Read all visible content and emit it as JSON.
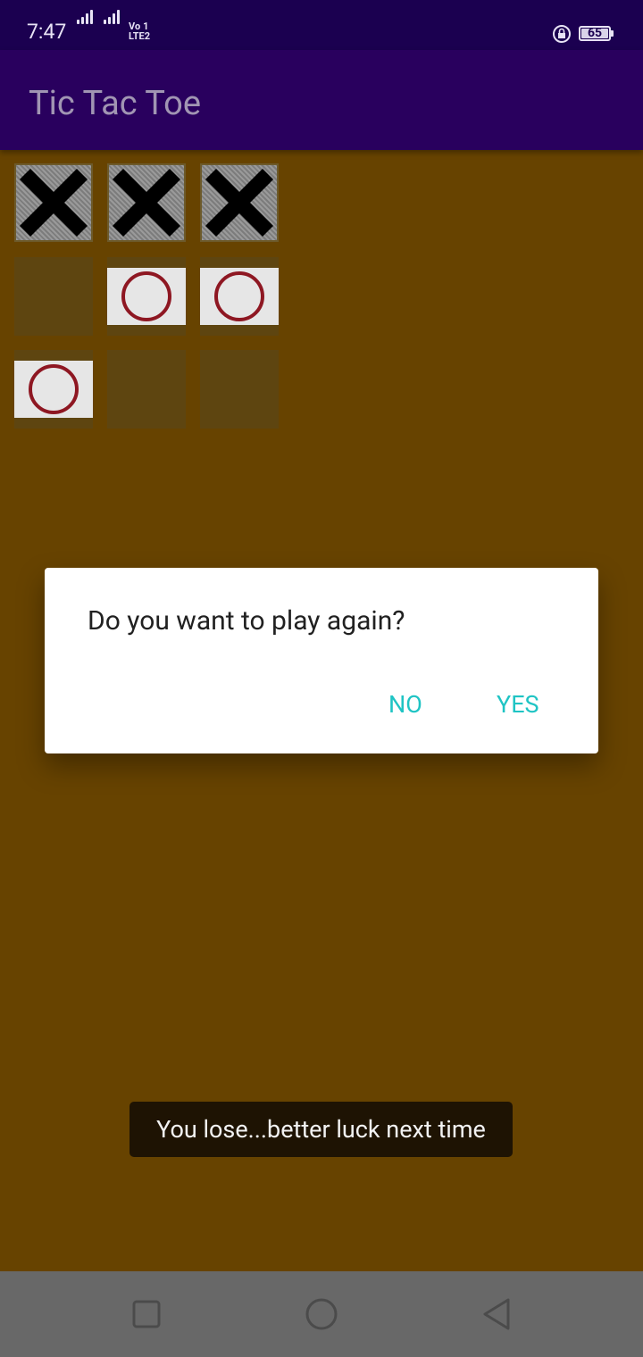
{
  "status_bar": {
    "time": "7:47",
    "network_label_top": "Vo",
    "network_label_bottom": "LTE",
    "sim_top": "1",
    "sim_bottom": "2",
    "battery_level": "65"
  },
  "app_bar": {
    "title": "Tic Tac Toe"
  },
  "board": {
    "cells": [
      "X",
      "X",
      "X",
      "",
      "O",
      "O",
      "O",
      "",
      ""
    ]
  },
  "dialog": {
    "message": "Do you want to play again?",
    "negative_label": "NO",
    "positive_label": "YES"
  },
  "toast": {
    "message": "You lose...better luck next time"
  },
  "nav_bar": {
    "icons": [
      "square-recents-icon",
      "circle-home-icon",
      "triangle-back-icon"
    ]
  },
  "colors": {
    "status_bar": "#1b0050",
    "app_bar": "#29005e",
    "background": "#674300",
    "accent": "#1fc4c4",
    "o_mark": "#8e1722"
  }
}
